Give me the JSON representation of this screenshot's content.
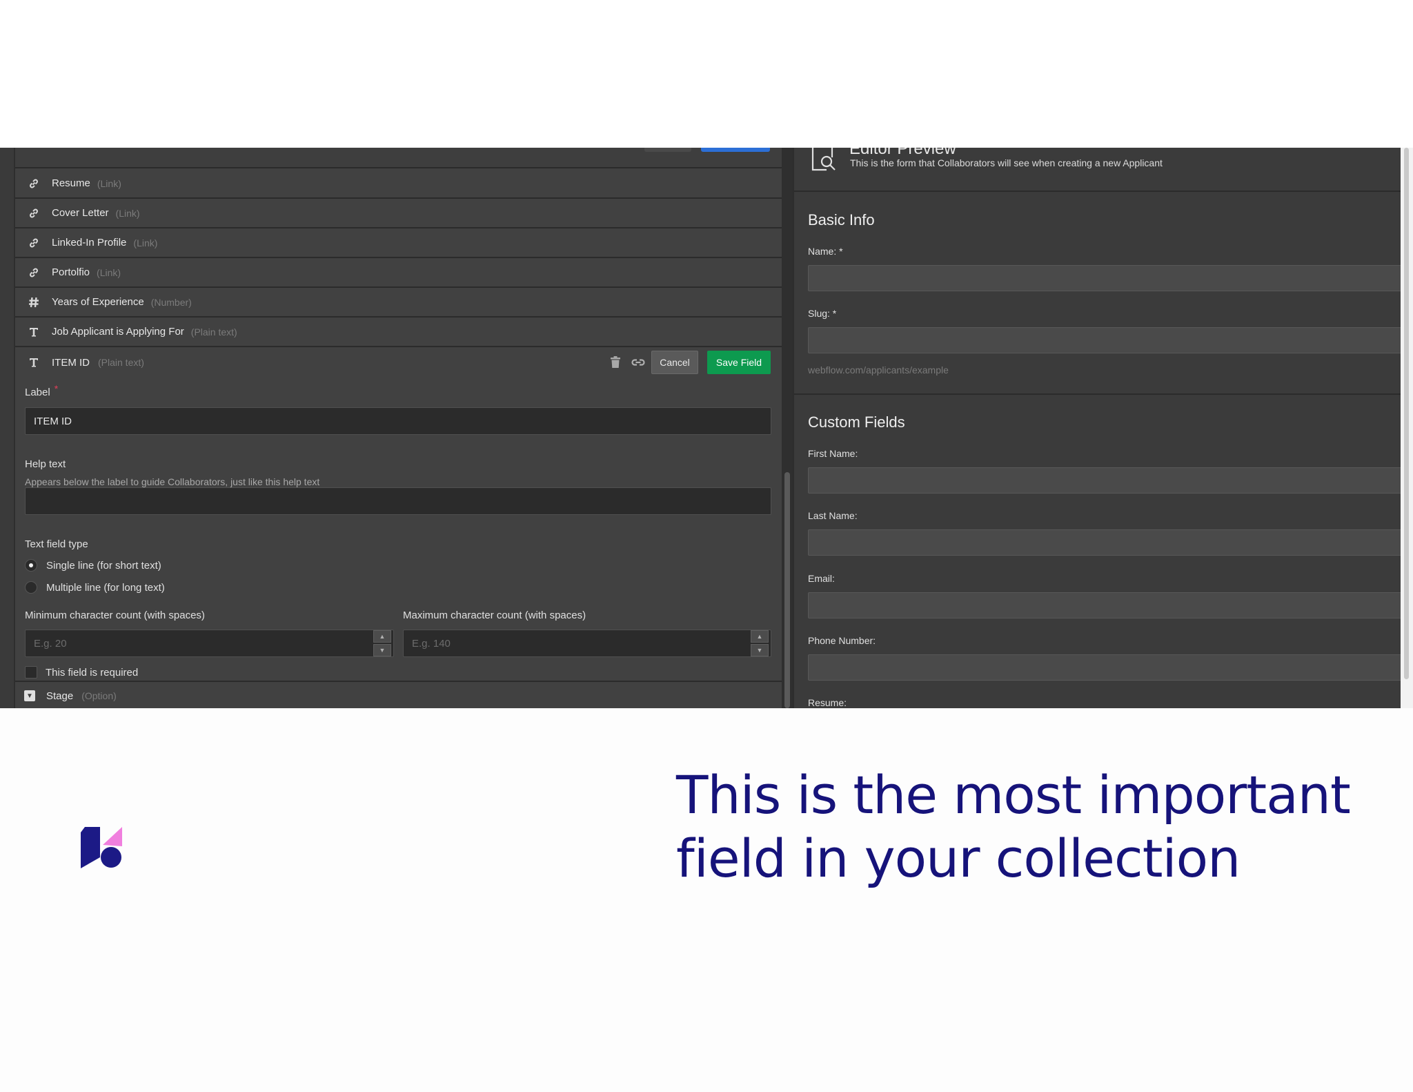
{
  "fields": [
    {
      "label": "Resume",
      "type": "(Link)",
      "icon": "link-icon"
    },
    {
      "label": "Cover Letter",
      "type": "(Link)",
      "icon": "link-icon"
    },
    {
      "label": "Linked-In Profile",
      "type": "(Link)",
      "icon": "link-icon"
    },
    {
      "label": "Portolfio",
      "type": "(Link)",
      "icon": "link-icon"
    },
    {
      "label": "Years of Experience",
      "type": "(Number)",
      "icon": "hash-icon"
    },
    {
      "label": "Job Applicant is Applying For",
      "type": "(Plain text)",
      "icon": "text-icon"
    }
  ],
  "editing": {
    "name": "ITEM ID",
    "type": "(Plain text)",
    "cancel_label": "Cancel",
    "save_label": "Save Field",
    "label_caption": "Label",
    "label_required": "*",
    "label_value": "ITEM ID",
    "help_caption": "Help text",
    "help_description": "Appears below the label to guide Collaborators, just like this help text",
    "help_value": "",
    "text_type_caption": "Text field type",
    "single_line": "Single line (for short text)",
    "multiple_line": "Multiple line (for long text)",
    "min_caption": "Minimum character count (with spaces)",
    "min_placeholder": "E.g. 20",
    "max_caption": "Maximum character count (with spaces)",
    "max_placeholder": "E.g. 140",
    "required_label": "This field is required",
    "selected_text_type": "Single line (for short text)",
    "required_checked": false
  },
  "stage": {
    "label": "Stage",
    "type": "(Option)"
  },
  "preview": {
    "title": "Editor Preview",
    "subtitle": "This is the form that Collaborators will see when creating a new Applicant",
    "basic_info": "Basic Info",
    "name_label": "Name: *",
    "slug_label": "Slug: *",
    "slug_hint": "webflow.com/applicants/example",
    "custom_fields": "Custom Fields",
    "first_name": "First Name:",
    "last_name": "Last Name:",
    "email": "Email:",
    "phone": "Phone Number:",
    "resume": "Resume:"
  },
  "headline": {
    "line1": "This is the most important",
    "line2": "field in your collection"
  },
  "colors": {
    "save_green": "#0d9a4f",
    "headline_navy": "#16137a",
    "logo_navy": "#1c1a86",
    "logo_pink": "#f07fde"
  }
}
